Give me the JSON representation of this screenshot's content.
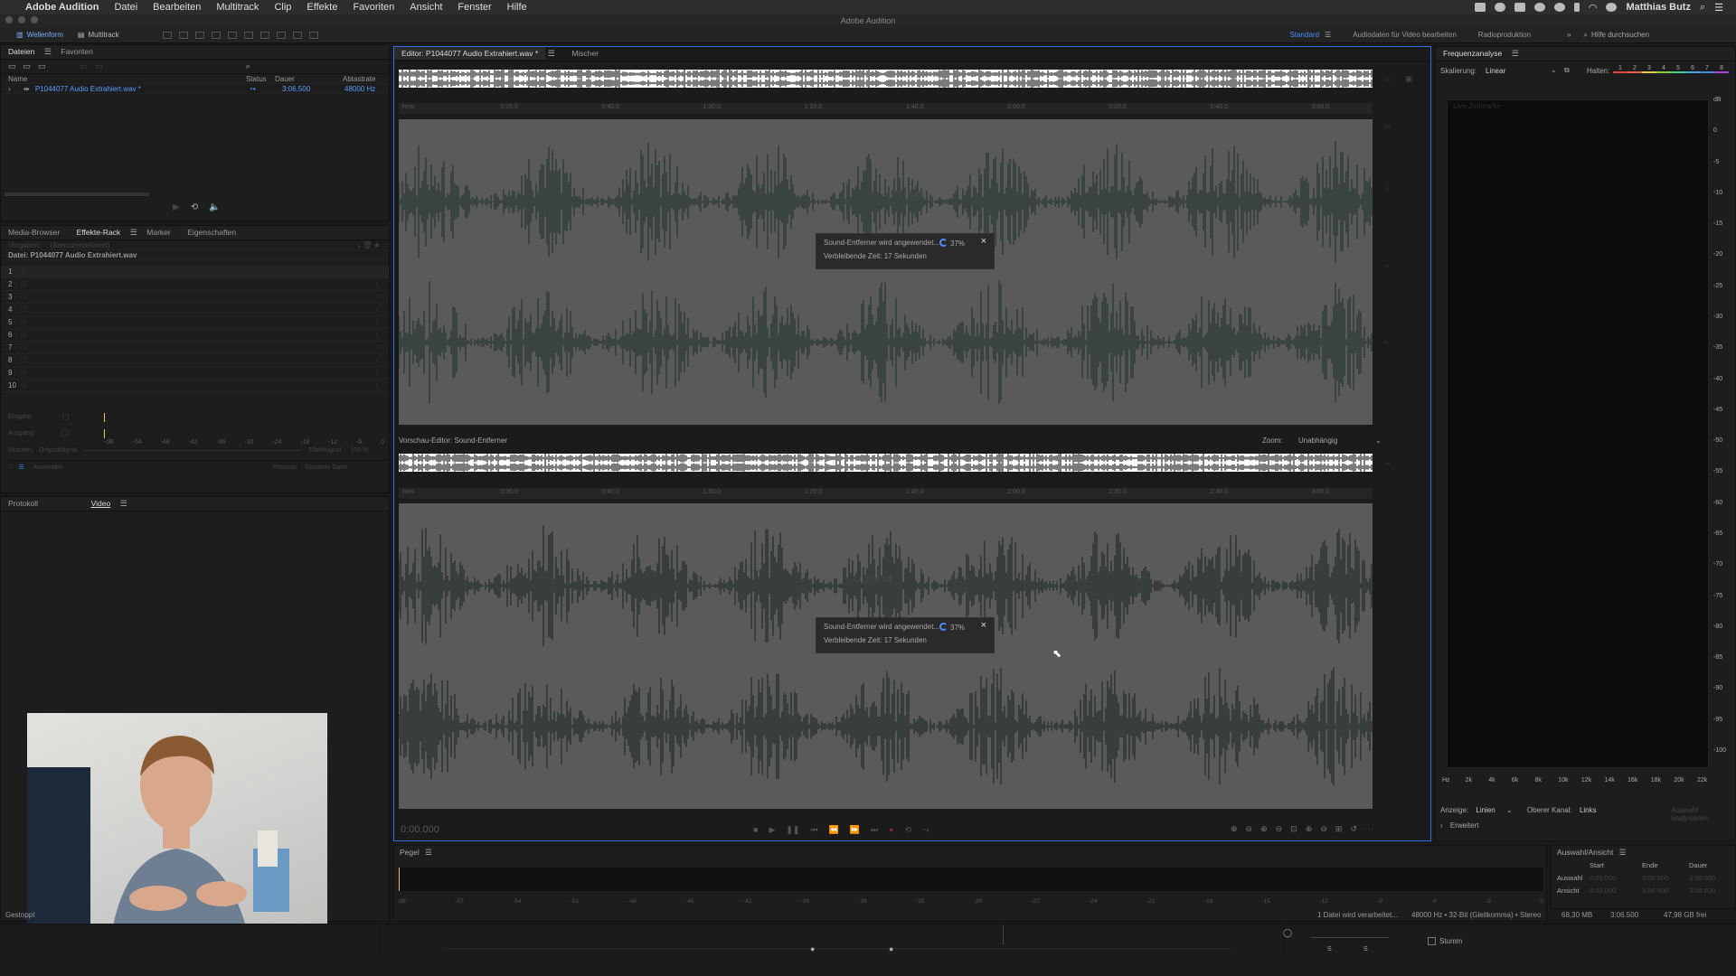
{
  "menubar": {
    "app": "Adobe Audition",
    "items": [
      "Datei",
      "Bearbeiten",
      "Multitrack",
      "Clip",
      "Effekte",
      "Favoriten",
      "Ansicht",
      "Fenster",
      "Hilfe"
    ],
    "user": "Matthias Butz"
  },
  "window_title": "Adobe Audition",
  "toolbar": {
    "waveform": "Wellenform",
    "multitrack": "Multitrack",
    "workspaces": [
      "Standard",
      "Audiodaten für Video bearbeiten",
      "Radioproduktion"
    ],
    "help_search": "Hilfe durchsuchen"
  },
  "files_panel": {
    "tabs": [
      "Dateien",
      "Favoriten"
    ],
    "columns": {
      "name": "Name",
      "status": "Status",
      "duration": "Dauer",
      "samplerate": "Abtastrate"
    },
    "file": {
      "name": "P1044077 Audio Extrahiert.wav *",
      "duration": "3:06.500",
      "samplerate": "48000 Hz"
    }
  },
  "effects_panel": {
    "tabs": [
      "Media-Browser",
      "Effekte-Rack",
      "Marker",
      "Eigenschaften"
    ],
    "preset_label": "Vorgaben:",
    "preset_value": "(Benutzerdefiniert)",
    "file_label": "Datei: P1044077 Audio Extrahiert.wav",
    "slots": [
      "1",
      "2",
      "3",
      "4",
      "5",
      "6",
      "7",
      "8",
      "9",
      "10"
    ],
    "input_label": "Eingabe:",
    "output_label": "Ausgang:",
    "mix_label": "Mischen:",
    "dry": "Originalsignal",
    "wet": "Effektsignal",
    "wet_pct": "100 %",
    "apply": "Anwenden",
    "process_label": "Prozess:",
    "process_value": "Gesamte Datei",
    "meter_ticks": [
      "-dB",
      "-54",
      "-48",
      "-42",
      "-36",
      "-30",
      "-24",
      "-18",
      "-12",
      "-6",
      "0"
    ]
  },
  "history_panel": {
    "tabs": [
      "Protokoll",
      "Video"
    ]
  },
  "editor": {
    "tabs": [
      "Editor: P1044077 Audio Extrahiert.wav *",
      "Mischer"
    ],
    "time_ticks": [
      "hms",
      "0:20.0",
      "0:40.0",
      "1:00.0",
      "1:20.0",
      "1:40.0",
      "2:00.0",
      "2:20.0",
      "2:40.0",
      "3:00.0"
    ],
    "toast_text": "Sound-Entferner wird angewendet...",
    "toast_pct": "37%",
    "toast_remaining": "Verbleibende Zeit: 17 Sekunden",
    "preview_title": "Vorschau-Editor: Sound-Entferner",
    "zoom_label": "Zoom:",
    "zoom_value": "Unabhängig",
    "timecode": "0:00.000"
  },
  "freq_panel": {
    "title": "Frequenzanalyse",
    "scale_label": "Skalierung:",
    "scale_value": "Linear",
    "hold_label": "Halten:",
    "hold_buttons": [
      "1",
      "2",
      "3",
      "4",
      "5",
      "6",
      "7",
      "8"
    ],
    "live_label": "Live-Zeitmarke",
    "db_ticks": [
      "dB",
      "0",
      "-5",
      "-10",
      "-15",
      "-20",
      "-25",
      "-30",
      "-35",
      "-40",
      "-45",
      "-50",
      "-55",
      "-60",
      "-65",
      "-70",
      "-75",
      "-80",
      "-85",
      "-90",
      "-95",
      "-100"
    ],
    "hz_ticks": [
      "Hz",
      "2k",
      "4k",
      "6k",
      "8k",
      "10k",
      "12k",
      "14k",
      "16k",
      "18k",
      "20k",
      "22k"
    ],
    "display_label": "Anzeige:",
    "display_value": "Linien",
    "channel_label": "Oberer Kanal:",
    "channel_value": "Links",
    "analyze": "Auswahl analysieren",
    "advanced": "Erweitert"
  },
  "levels_panel": {
    "title": "Pegel",
    "ticks": [
      "dB",
      "-57",
      "-54",
      "-51",
      "-48",
      "-45",
      "-42",
      "-39",
      "-36",
      "-33",
      "-30",
      "-27",
      "-24",
      "-21",
      "-18",
      "-15",
      "-12",
      "-9",
      "-6",
      "-3",
      "0"
    ]
  },
  "selection_panel": {
    "title": "Auswahl/Ansicht",
    "cols": [
      "Start",
      "Ende",
      "Dauer"
    ],
    "rows": [
      {
        "label": "Auswahl",
        "start": "0:00.000",
        "end": "3:06.500",
        "dur": "3:06.500"
      },
      {
        "label": "Ansicht",
        "start": "0:00.000",
        "end": "3:06.500",
        "dur": "3:06.500"
      }
    ]
  },
  "statusbar": {
    "stopped": "Gestoppt",
    "processing": "1 Datei wird verarbeitet...",
    "format": "48000 Hz • 32-Bit (Gleitkomma) • Stereo",
    "size1": "68,30 MB",
    "dur": "3:06.500",
    "free": "47,98 GB frei",
    "mute": "Stumm"
  },
  "colors": {
    "accent": "#4c8cff",
    "waveform": "#2e3a37",
    "wave_bg": "#5a5a5a",
    "panel": "#1d1d1d"
  }
}
